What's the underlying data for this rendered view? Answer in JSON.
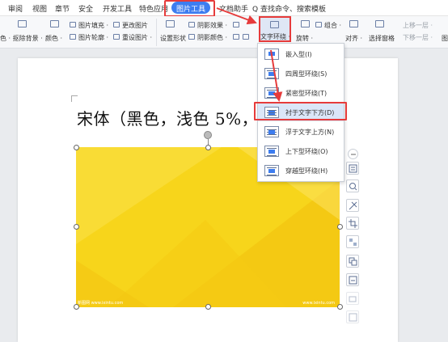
{
  "menu": {
    "items": [
      "审阅",
      "视图",
      "章节",
      "安全",
      "开发工具",
      "特色应用",
      "图片工具",
      "文档助手",
      "Q 查找命令、搜索模板"
    ]
  },
  "ribbon": {
    "remove_bg": "色 · 抠除背景 ·",
    "color": "颜色 ·",
    "fill": "图片填充 ·",
    "outline": "图片轮廓 ·",
    "change_image": "更改图片",
    "reset_image": "重设图片 ·",
    "set_shape": "设置形状",
    "shadow_effect": "阴影效果 ·",
    "shadow_color": "阴影颜色 ·",
    "text_wrap": "文字环绕 ·",
    "rotate": "旋转 ·",
    "combine": "组合 ·",
    "align": "对齐 ·",
    "selection_pane": "选择窗格",
    "bring_forward": "上移一层 ·",
    "send_backward": "下移一层 ·",
    "more": "图"
  },
  "wrap_menu": {
    "items": [
      "嵌入型(I)",
      "四周型环绕(S)",
      "紧密型环绕(T)",
      "衬于文字下方(D)",
      "浮于文字上方(N)",
      "上下型环绕(O)",
      "穿越型环绕(H)"
    ],
    "selected_index": 3
  },
  "document": {
    "text": "宋体（黑色，浅色 5%，"
  },
  "image": {
    "watermark_left": "新图网 www.ixintu.com",
    "watermark_right": "www.ixintu.com",
    "color": "#f7d51b"
  },
  "colors": {
    "accent": "#3d7df0",
    "highlight": "#e63b3b"
  }
}
